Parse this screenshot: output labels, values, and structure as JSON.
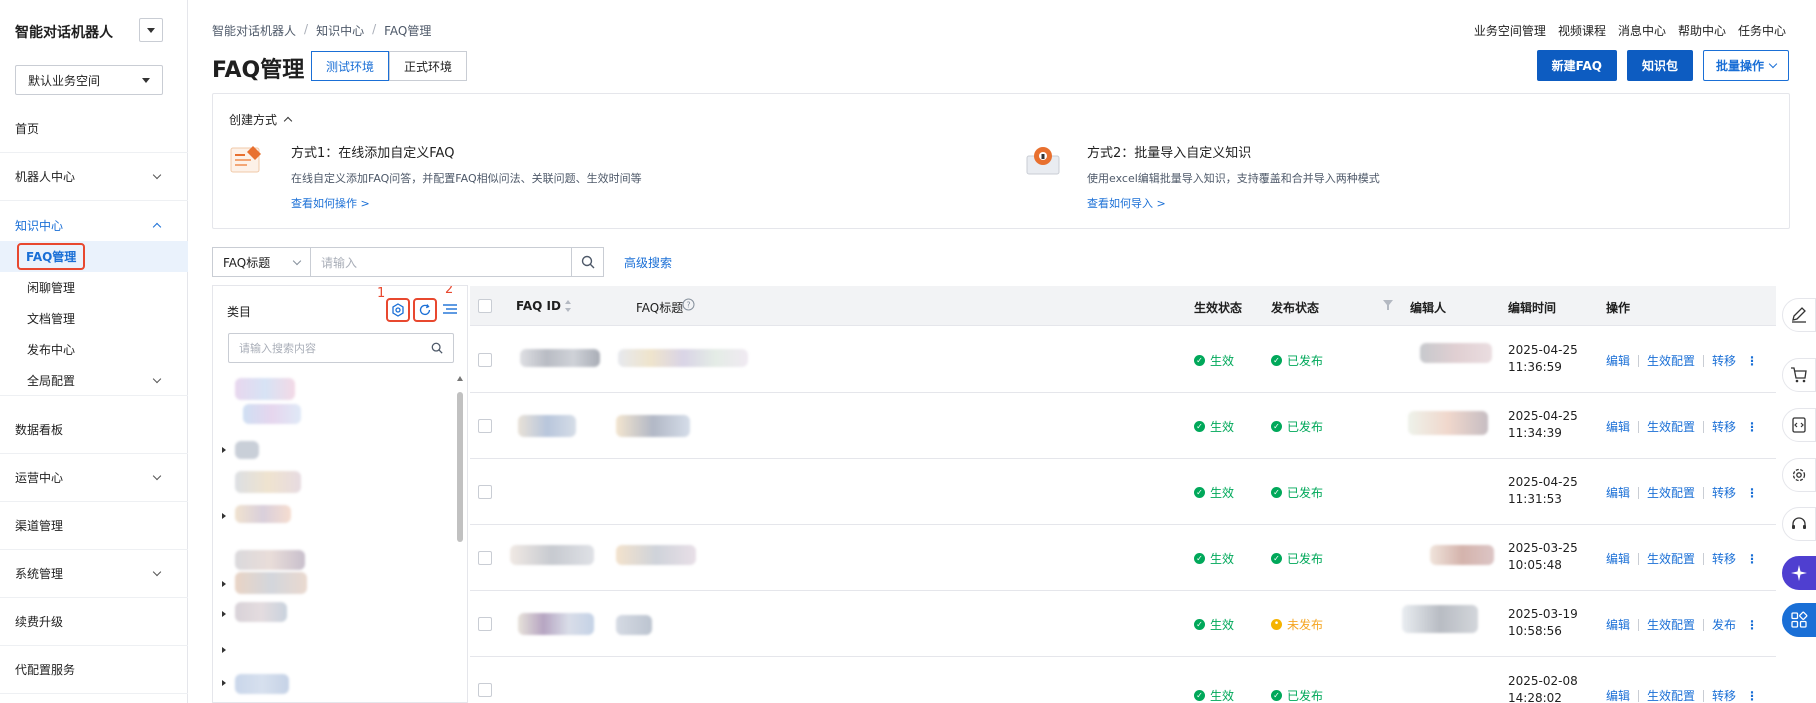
{
  "brand": {
    "title": "智能对话机器人"
  },
  "workspace": {
    "value": "默认业务空间"
  },
  "nav": {
    "items": [
      {
        "label": "首页"
      },
      {
        "label": "机器人中心"
      },
      {
        "label": "知识中心"
      },
      {
        "label": "数据看板"
      },
      {
        "label": "运营中心"
      },
      {
        "label": "渠道管理"
      },
      {
        "label": "系统管理"
      },
      {
        "label": "续费升级"
      },
      {
        "label": "代配置服务"
      }
    ],
    "sub_items": [
      {
        "label": "FAQ管理"
      },
      {
        "label": "闲聊管理"
      },
      {
        "label": "文档管理"
      },
      {
        "label": "发布中心"
      },
      {
        "label": "全局配置"
      }
    ]
  },
  "breadcrumb": {
    "items": [
      "智能对话机器人",
      "知识中心",
      "FAQ管理"
    ],
    "sep": "/"
  },
  "toplinks": [
    "业务空间管理",
    "视频课程",
    "消息中心",
    "帮助中心",
    "任务中心"
  ],
  "page": {
    "title": "FAQ管理"
  },
  "env_tabs": [
    "测试环境",
    "正式环境"
  ],
  "actions": {
    "new_faq": "新建FAQ",
    "knowledge_pack": "知识包",
    "batch": "批量操作"
  },
  "create": {
    "header": "创建方式",
    "methods": [
      {
        "title": "方式1：在线添加自定义FAQ",
        "desc": "在线自定义添加FAQ问答，并配置FAQ相似问法、关联问题、生效时间等",
        "link": "查看如何操作 >"
      },
      {
        "title": "方式2：批量导入自定义知识",
        "desc": "使用excel编辑批量导入知识，支持覆盖和合并导入两种模式",
        "link": "查看如何导入 >"
      }
    ]
  },
  "search": {
    "field": "FAQ标题",
    "placeholder": "请输入",
    "advanced": "高级搜索"
  },
  "category": {
    "title": "类目",
    "search_placeholder": "请输入搜索内容",
    "annotations": [
      "1",
      "2"
    ]
  },
  "table": {
    "headers": {
      "id": "FAQ ID",
      "title": "FAQ标题",
      "effect": "生效状态",
      "publish": "发布状态",
      "editor": "编辑人",
      "time": "编辑时间",
      "ops": "操作"
    },
    "rows": [
      {
        "effect": "生效",
        "publish": "已发布",
        "publish_state": "ok",
        "date": "2025-04-25",
        "time": "11:36:59",
        "ops": [
          "编辑",
          "生效配置",
          "转移"
        ]
      },
      {
        "effect": "生效",
        "publish": "已发布",
        "publish_state": "ok",
        "date": "2025-04-25",
        "time": "11:34:39",
        "ops": [
          "编辑",
          "生效配置",
          "转移"
        ]
      },
      {
        "effect": "生效",
        "publish": "已发布",
        "publish_state": "ok",
        "date": "2025-04-25",
        "time": "11:31:53",
        "ops": [
          "编辑",
          "生效配置",
          "转移"
        ]
      },
      {
        "effect": "生效",
        "publish": "已发布",
        "publish_state": "ok",
        "date": "2025-03-25",
        "time": "10:05:48",
        "ops": [
          "编辑",
          "生效配置",
          "转移"
        ]
      },
      {
        "effect": "生效",
        "publish": "未发布",
        "publish_state": "pending",
        "date": "2025-03-19",
        "time": "10:58:56",
        "ops": [
          "编辑",
          "生效配置",
          "发布"
        ]
      },
      {
        "effect": "生效",
        "publish": "已发布",
        "publish_state": "ok",
        "date": "2025-02-08",
        "time": "14:28:02",
        "ops": [
          "编辑",
          "生效配置",
          "转移"
        ]
      }
    ]
  },
  "colors": {
    "primary": "#0d5cc1",
    "link": "#1a6fd6",
    "success": "#00a85a",
    "warning": "#f5b300",
    "annotation": "#e8482f"
  },
  "icons": [
    "chevron-down-icon",
    "search-icon",
    "settings-icon",
    "refresh-icon",
    "menu-icon",
    "sort-icon",
    "help-icon",
    "filter-icon",
    "edit-icon",
    "cart-icon",
    "code-icon",
    "headset-icon",
    "apps-icon"
  ]
}
